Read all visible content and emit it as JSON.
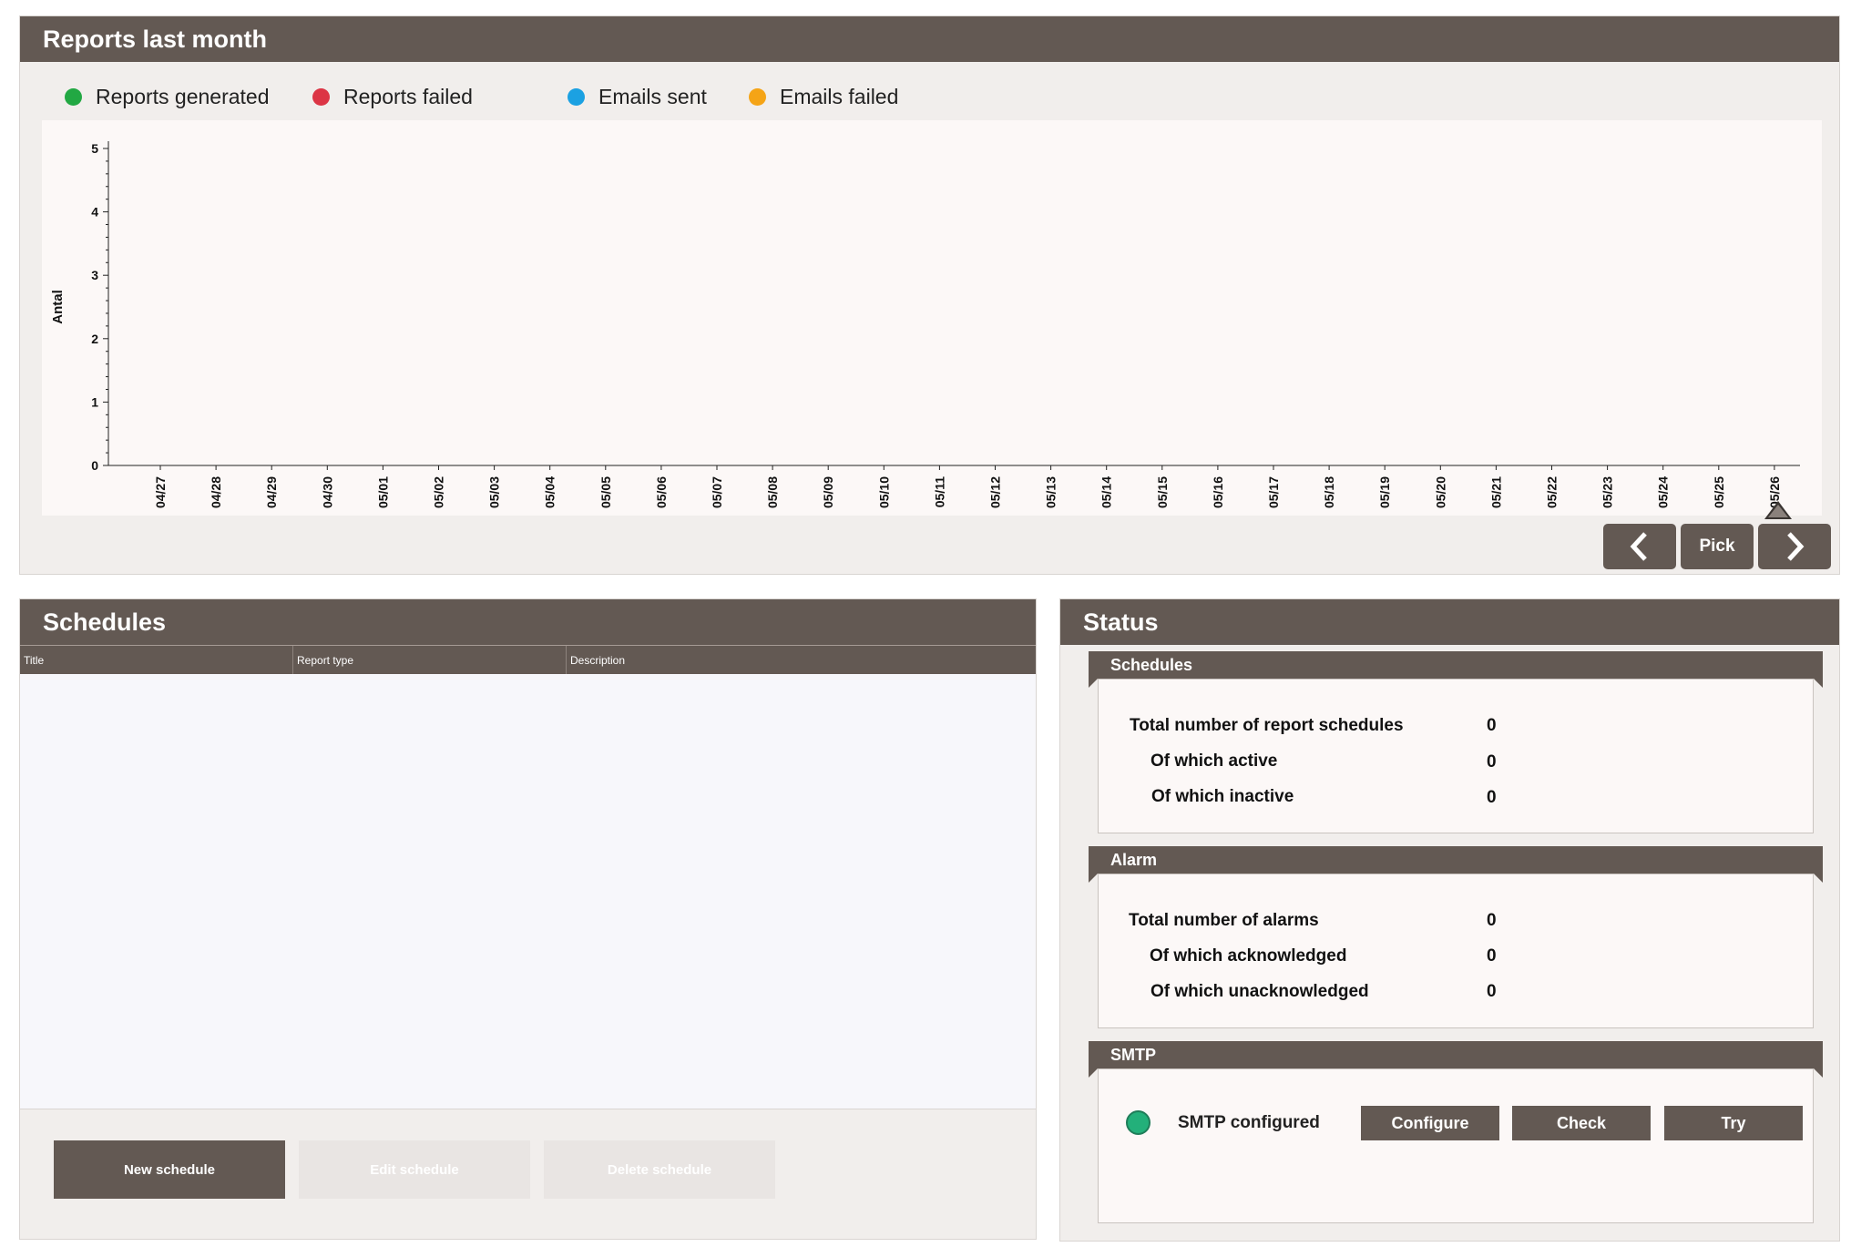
{
  "reports": {
    "title": "Reports last month",
    "legend": [
      {
        "label": "Reports generated",
        "color": "#22a843"
      },
      {
        "label": "Reports failed",
        "color": "#dc3545"
      },
      {
        "label": "Emails sent",
        "color": "#1ba1e2"
      },
      {
        "label": "Emails failed",
        "color": "#f5a416"
      }
    ],
    "nav": {
      "prev_icon": "chevron-left-icon",
      "pick_label": "Pick",
      "next_icon": "chevron-right-icon"
    }
  },
  "chart_data": {
    "type": "line",
    "ylabel": "Antal",
    "xlabel": "",
    "ylim": [
      0,
      5
    ],
    "yticks": [
      "0",
      "1",
      "2",
      "3",
      "4",
      "5"
    ],
    "categories": [
      "04/27",
      "04/28",
      "04/29",
      "04/30",
      "05/01",
      "05/02",
      "05/03",
      "05/04",
      "05/05",
      "05/06",
      "05/07",
      "05/08",
      "05/09",
      "05/10",
      "05/11",
      "05/12",
      "05/13",
      "05/14",
      "05/15",
      "05/16",
      "05/17",
      "05/18",
      "05/19",
      "05/20",
      "05/21",
      "05/22",
      "05/23",
      "05/24",
      "05/25",
      "05/26"
    ],
    "series": [
      {
        "name": "Reports generated",
        "values": []
      },
      {
        "name": "Reports failed",
        "values": []
      },
      {
        "name": "Emails sent",
        "values": []
      },
      {
        "name": "Emails failed",
        "values": []
      }
    ],
    "grid": false
  },
  "schedules": {
    "title": "Schedules",
    "columns": [
      "Title",
      "Report type",
      "Description"
    ],
    "rows": [],
    "buttons": {
      "new": "New schedule",
      "edit": "Edit schedule",
      "delete": "Delete schedule"
    }
  },
  "status": {
    "title": "Status",
    "schedules": {
      "title": "Schedules",
      "rows": [
        {
          "label": "Total number of report schedules",
          "value": "0"
        },
        {
          "label": "Of which active",
          "value": "0"
        },
        {
          "label": "Of which inactive",
          "value": "0"
        }
      ]
    },
    "alarm": {
      "title": "Alarm",
      "rows": [
        {
          "label": "Total number of alarms",
          "value": "0"
        },
        {
          "label": "Of which acknowledged",
          "value": "0"
        },
        {
          "label": "Of which unacknowledged",
          "value": "0"
        }
      ]
    },
    "smtp": {
      "title": "SMTP",
      "status_label": "SMTP configured",
      "status_color": "#23b07a",
      "buttons": {
        "configure": "Configure",
        "check": "Check",
        "try": "Try"
      }
    }
  }
}
